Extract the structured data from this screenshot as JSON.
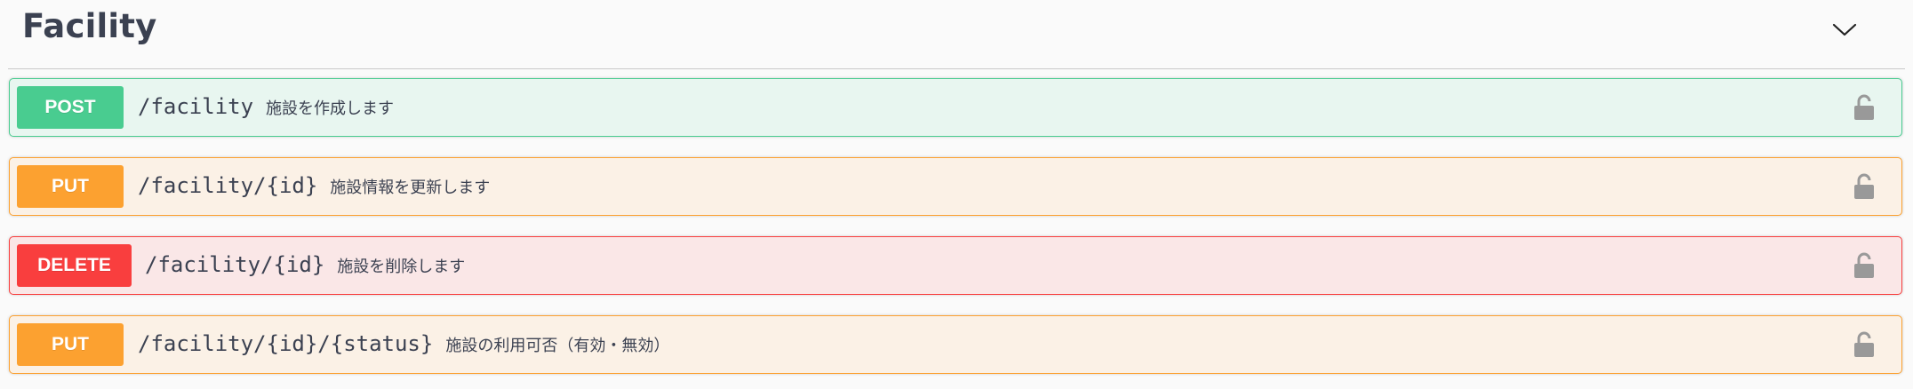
{
  "section": {
    "title": "Facility",
    "toggle_icon": "chevron-down-icon"
  },
  "operations": [
    {
      "method": "POST",
      "path": "/facility",
      "summary": "施設を作成します",
      "color": "#49cc90",
      "lock_icon": "unlocked-padlock-icon"
    },
    {
      "method": "PUT",
      "path": "/facility/{id}",
      "summary": "施設情報を更新します",
      "color": "#fca130",
      "lock_icon": "unlocked-padlock-icon"
    },
    {
      "method": "DELETE",
      "path": "/facility/{id}",
      "summary": "施設を削除します",
      "color": "#f93e3e",
      "lock_icon": "unlocked-padlock-icon"
    },
    {
      "method": "PUT",
      "path": "/facility/{id}/{status}",
      "summary": "施設の利用可否（有効・無効）",
      "color": "#fca130",
      "lock_icon": "unlocked-padlock-icon"
    }
  ],
  "colors": {
    "title": "#3b4151",
    "lock": "#999999"
  }
}
